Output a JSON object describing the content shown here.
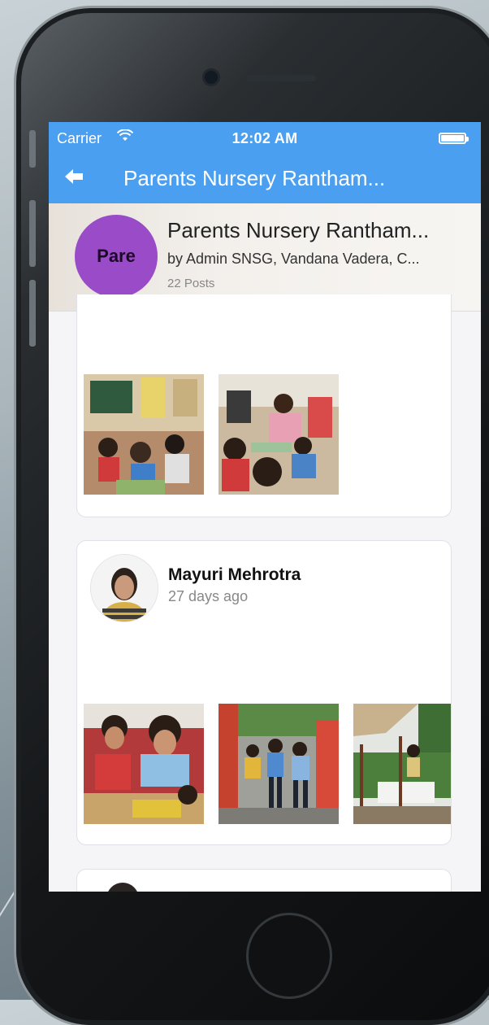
{
  "status_bar": {
    "carrier": "Carrier",
    "time": "12:02 AM"
  },
  "nav": {
    "back_icon": "back-arrow-icon",
    "title": "Parents Nursery Rantham..."
  },
  "group": {
    "avatar_text": "Pare",
    "avatar_color": "#9a4bc8",
    "name": "Parents Nursery Rantham...",
    "members": "by Admin SNSG, Vandana Vadera, C...",
    "posts": "22 Posts"
  },
  "posts": [
    {
      "photos": [
        "classroom-photo-1",
        "classroom-photo-2"
      ]
    },
    {
      "author": "Mayuri Mehrotra",
      "time": "27 days ago",
      "photos": [
        "kids-photo-1",
        "kids-photo-2",
        "playground-photo-3"
      ]
    }
  ],
  "colors": {
    "accent": "#4a9ff0"
  }
}
